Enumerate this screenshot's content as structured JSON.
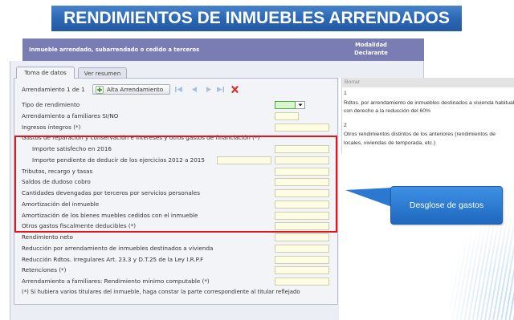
{
  "banner": {
    "title": "RENDIMIENTOS DE INMUEBLES ARRENDADOS"
  },
  "header": {
    "title": "Inmueble arrendado, subarrendado o cedido a terceros",
    "modality_line1": "Modalidad",
    "modality_line2": "Declarante"
  },
  "tabs": [
    {
      "label": "Toma de datos"
    },
    {
      "label": "Ver resumen"
    }
  ],
  "record": {
    "counter": "Arrendamiento 1 de 1",
    "add_button_label": "Alta Arrendamiento"
  },
  "form": {
    "fields": [
      {
        "label": "Tipo de rendimiento",
        "value": ""
      },
      {
        "label": "Arrendamiento a familiares SI/NO",
        "value": ""
      },
      {
        "label": "Ingresos íntegros (*)",
        "value": ""
      },
      {
        "label": "Gastos de reparación y conservación e intereses y otros gastos de financiación (*)"
      },
      {
        "label": "Importe satisfecho en 2016",
        "value": ""
      },
      {
        "label": "Importe pendiente de deducir de los ejercicios 2012 a 2015",
        "value": "",
        "secondary_value": ""
      },
      {
        "label": "Tributos, recargo y tasas",
        "value": ""
      },
      {
        "label": "Saldos de dudoso cobro",
        "value": ""
      },
      {
        "label": "Cantidades devengadas por terceros por servicios personales",
        "value": ""
      },
      {
        "label": "Amortización del inmueble",
        "value": ""
      },
      {
        "label": "Amortización de los bienes muebles cedidos con el inmueble",
        "value": ""
      },
      {
        "label": "Otros gastos fiscalmente deducibles (*)",
        "value": ""
      },
      {
        "label": "Rendimiento neto",
        "value": ""
      },
      {
        "label": "Reducción por arrendamiento de inmuebles destinados a vivienda",
        "value": ""
      },
      {
        "label": "Reducción Rdtos. irregulares Art. 23.3 y D.T.25 de la Ley I.R.P.F",
        "value": ""
      },
      {
        "label": "Retenciones (*)",
        "value": ""
      },
      {
        "label": "Arrendamiento a familiares: Rendimiento mínimo computable (*)",
        "value": ""
      }
    ],
    "footnote": "(*) Si hubiera varios titulares del inmueble, haga constar la parte correspondiente al titular reflejado"
  },
  "dropdown": {
    "clear_option": "Borrar",
    "options": [
      {
        "number": "1",
        "lines": [
          "Rdtos. por arrendamiento de inmuebles destinados a vivienda habitual",
          "con derecho a la reducción del 60%"
        ]
      },
      {
        "number": "2",
        "lines": [
          "Otros rendimientos distintos de los anteriores (rendimientos de",
          "locales, viviendas de temporada, etc.)"
        ]
      }
    ]
  },
  "callout": {
    "text": "Desglose de gastos"
  },
  "icons": {
    "add": "plus-icon",
    "first": "first-record-icon",
    "previous": "previous-record-icon",
    "next": "next-record-icon",
    "last": "last-record-icon",
    "delete": "delete-record-icon",
    "dropdown": "dropdown-arrow-icon"
  },
  "colors": {
    "banner": "#2b65b3",
    "header_bar": "#7a7cb4",
    "highlight": "#e3141b",
    "callout": "#2a78cf",
    "input_bg": "#fdfde4",
    "select_bg": "#dcf4d2"
  }
}
